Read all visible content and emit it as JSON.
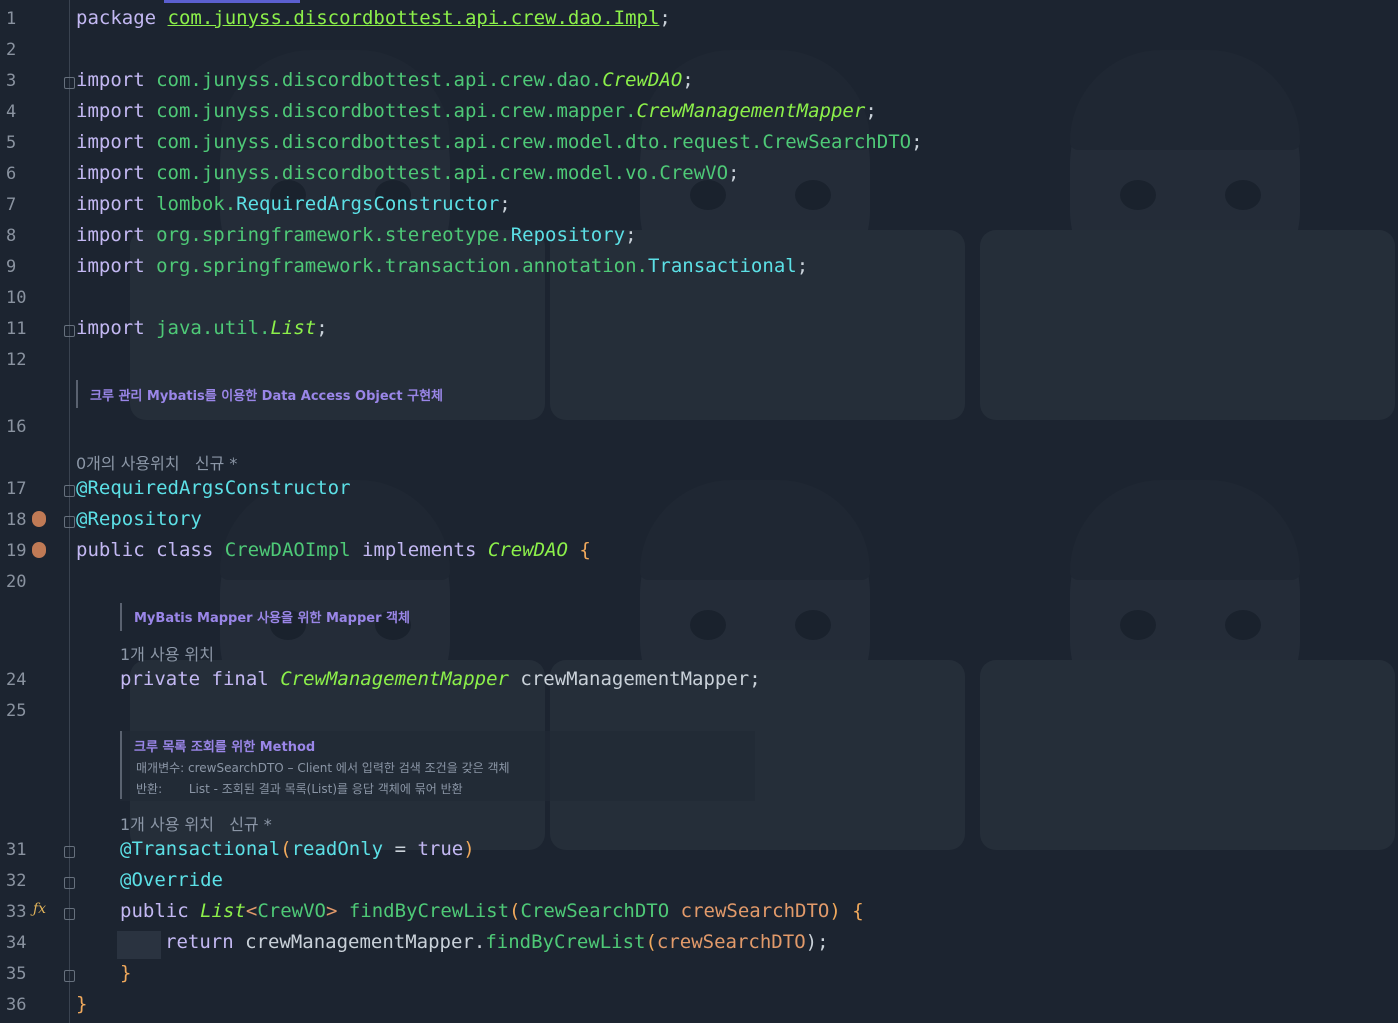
{
  "lines": {
    "l1": {
      "n": "1",
      "kw": "package",
      "pkg": "com.junyss.discordbottest.api.crew.dao.Impl",
      "end": ";"
    },
    "l2": {
      "n": "2"
    },
    "l3": {
      "n": "3",
      "kw": "import",
      "pkg": "com.junyss.discordbottest.api.crew.dao.",
      "cls": "CrewDAO",
      "end": ";"
    },
    "l4": {
      "n": "4",
      "kw": "import",
      "pkg": "com.junyss.discordbottest.api.crew.mapper.",
      "cls": "CrewManagementMapper",
      "end": ";"
    },
    "l5": {
      "n": "5",
      "kw": "import",
      "pkg": "com.junyss.discordbottest.api.crew.model.dto.request.CrewSearchDTO",
      "end": ";"
    },
    "l6": {
      "n": "6",
      "kw": "import",
      "pkg": "com.junyss.discordbottest.api.crew.model.vo.CrewVO",
      "end": ";"
    },
    "l7": {
      "n": "7",
      "kw": "import",
      "pkg": "lombok.",
      "cls": "RequiredArgsConstructor",
      "end": ";"
    },
    "l8": {
      "n": "8",
      "kw": "import",
      "pkg": "org.springframework.stereotype.",
      "cls": "Repository",
      "end": ";"
    },
    "l9": {
      "n": "9",
      "kw": "import",
      "pkg": "org.springframework.transaction.annotation.",
      "cls": "Transactional",
      "end": ";"
    },
    "l10": {
      "n": "10"
    },
    "l11": {
      "n": "11",
      "kw": "import",
      "pkg": "java.util.",
      "cls": "List",
      "end": ";"
    },
    "l12": {
      "n": "12"
    },
    "l16": {
      "n": "16"
    },
    "l17": {
      "n": "17",
      "ann": "@RequiredArgsConstructor"
    },
    "l18": {
      "n": "18",
      "ann": "@Repository"
    },
    "l19": {
      "n": "19",
      "kw1": "public",
      "kw2": "class",
      "name": "CrewDAOImpl",
      "kw3": "implements",
      "iface": "CrewDAO",
      "brace": "{"
    },
    "l20": {
      "n": "20"
    },
    "l24": {
      "n": "24",
      "kw1": "private",
      "kw2": "final",
      "type": "CrewManagementMapper",
      "field": "crewManagementMapper;"
    },
    "l25": {
      "n": "25"
    },
    "l31": {
      "n": "31",
      "ann": "@Transactional",
      "p1": "(",
      "arg": "readOnly",
      "eq": " = ",
      "val": "true",
      "p2": ")"
    },
    "l32": {
      "n": "32",
      "ann": "@Override"
    },
    "l33": {
      "n": "33",
      "kw": "public",
      "type": "List",
      "gen1": "<",
      "vo": "CrewVO",
      "gen2": ">",
      "method": "findByCrewList",
      "p1": "(",
      "ptype": "CrewSearchDTO",
      "pname": "crewSearchDTO",
      "p2": ")",
      "brace": "{"
    },
    "l34": {
      "n": "34",
      "kw": "return",
      "obj": "crewManagementMapper.",
      "method": "findByCrewList",
      "p1": "(",
      "arg": "crewSearchDTO",
      "p2": ");"
    },
    "l35": {
      "n": "35",
      "brace": "}"
    },
    "l36": {
      "n": "36",
      "brace": "}"
    }
  },
  "docs": {
    "class_doc": "크루 관리 Mybatis를 이용한 Data Access Object 구현체",
    "mapper_doc": "MyBatis Mapper 사용을 위한 Mapper 객체",
    "method_doc_title": "크루 목록 조회를 위한 Method",
    "method_doc_param": "매개변수: crewSearchDTO – Client 에서 입력한 검색 조건을 갖은 객체",
    "method_doc_return": "반환:       List - 조회된 결과 목록(List)를 응답 객체에 묶어 반환"
  },
  "hints": {
    "class_usage": "0개의 사용위치   신규 *",
    "field_usage": "1개 사용 위치",
    "method_usage": "1개 사용 위치   신규 *"
  },
  "icons": {
    "bean": "spring-bean-icon",
    "func": "function-override-icon"
  }
}
